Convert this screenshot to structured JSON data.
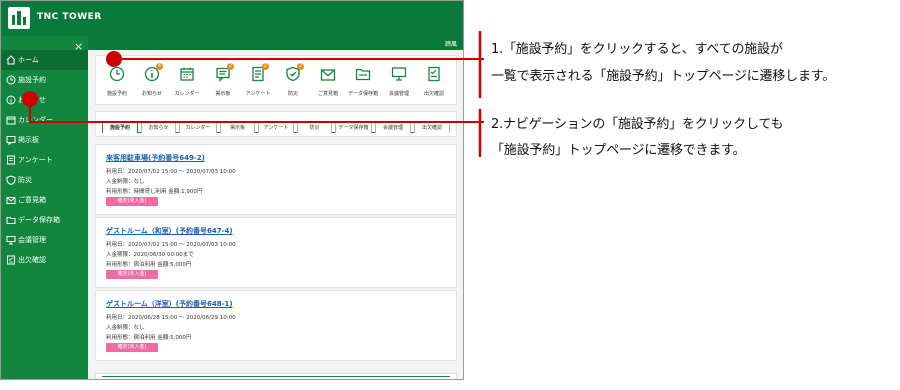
{
  "app": {
    "brand": "TNC TOWER",
    "header_label": "蹄風"
  },
  "sidebar": {
    "close_glyph": "×",
    "items": [
      {
        "label": "ホーム",
        "icon": "home-icon"
      },
      {
        "label": "施設予約",
        "icon": "clock-icon"
      },
      {
        "label": "お知らせ",
        "icon": "info-icon"
      },
      {
        "label": "カレンダー",
        "icon": "calendar-icon"
      },
      {
        "label": "掲示板",
        "icon": "message-icon"
      },
      {
        "label": "アンケート",
        "icon": "survey-icon"
      },
      {
        "label": "防災",
        "icon": "shield-icon"
      },
      {
        "label": "ご意見箱",
        "icon": "mail-icon"
      },
      {
        "label": "データ保存箱",
        "icon": "folder-icon"
      },
      {
        "label": "会議管理",
        "icon": "meeting-icon"
      },
      {
        "label": "出欠確認",
        "icon": "checklist-icon"
      }
    ]
  },
  "quick_icons": [
    {
      "label": "施設予約",
      "icon": "clock-icon"
    },
    {
      "label": "お知らせ",
      "icon": "info-icon",
      "badge": "4"
    },
    {
      "label": "カレンダー",
      "icon": "calendar-icon"
    },
    {
      "label": "掲示板",
      "icon": "message-icon",
      "badge": "2"
    },
    {
      "label": "アンケート",
      "icon": "survey-icon",
      "badge": "2"
    },
    {
      "label": "防災",
      "icon": "shield-icon",
      "badge": "2"
    },
    {
      "label": "ご意見箱",
      "icon": "mail-icon"
    },
    {
      "label": "データ保存箱",
      "icon": "folder-icon"
    },
    {
      "label": "会議管理",
      "icon": "meeting-icon"
    },
    {
      "label": "出欠確認",
      "icon": "checklist-icon"
    }
  ],
  "tabs": [
    {
      "label": "施設予約",
      "active": true
    },
    {
      "label": "お知らせ"
    },
    {
      "label": "カレンダー"
    },
    {
      "label": "掲示板"
    },
    {
      "label": "アンケート"
    },
    {
      "label": "防災"
    },
    {
      "label": "データ保存箱"
    },
    {
      "label": "会議管理"
    },
    {
      "label": "出欠確認"
    }
  ],
  "reservations": [
    {
      "title": "来客用駐車場(予約番号649-2)",
      "line1": "利用日：2020/07/02 15:00 ～ 2020/07/03 10:00",
      "line2": "入金制限：なし",
      "line3": "利用形態：時間貸し利用 金額:1,900円",
      "status": "確定(未入金)"
    },
    {
      "title": "ゲストルーム（和室）(予約番号647-4)",
      "line1": "利用日：2020/07/02 15:00 ～ 2020/07/03 10:00",
      "line2": "入金期限：2020/06/30 00:00まで",
      "line3": "利用形態：宿泊利用 金額:5,000円",
      "status": "確定(未入金)"
    },
    {
      "title": "ゲストルーム（洋室）(予約番号648-1)",
      "line1": "利用日：2020/06/28 15:00 ～ 2020/06/29 10:00",
      "line2": "入金制限：なし",
      "line3": "利用形態：宿泊利用 金額:5,000円",
      "status": "確定(未入金)"
    }
  ],
  "callouts": [
    {
      "line1": "1.「施設予約」をクリックすると、すべての施設が",
      "line2": "一覧で表示される「施設予約」トップページに遷移します。"
    },
    {
      "line1": "2.ナビゲーションの「施設予約」をクリックしても",
      "line2": "「施設予約」トップページに遷移できます。"
    }
  ],
  "colors": {
    "brand_green": "#0a7a3a",
    "sidebar_green": "#12863f",
    "link_blue": "#1a5fb4",
    "status_pink": "#f06aa3",
    "badge_orange": "#e98a1a",
    "marker_red": "#cc0000"
  }
}
